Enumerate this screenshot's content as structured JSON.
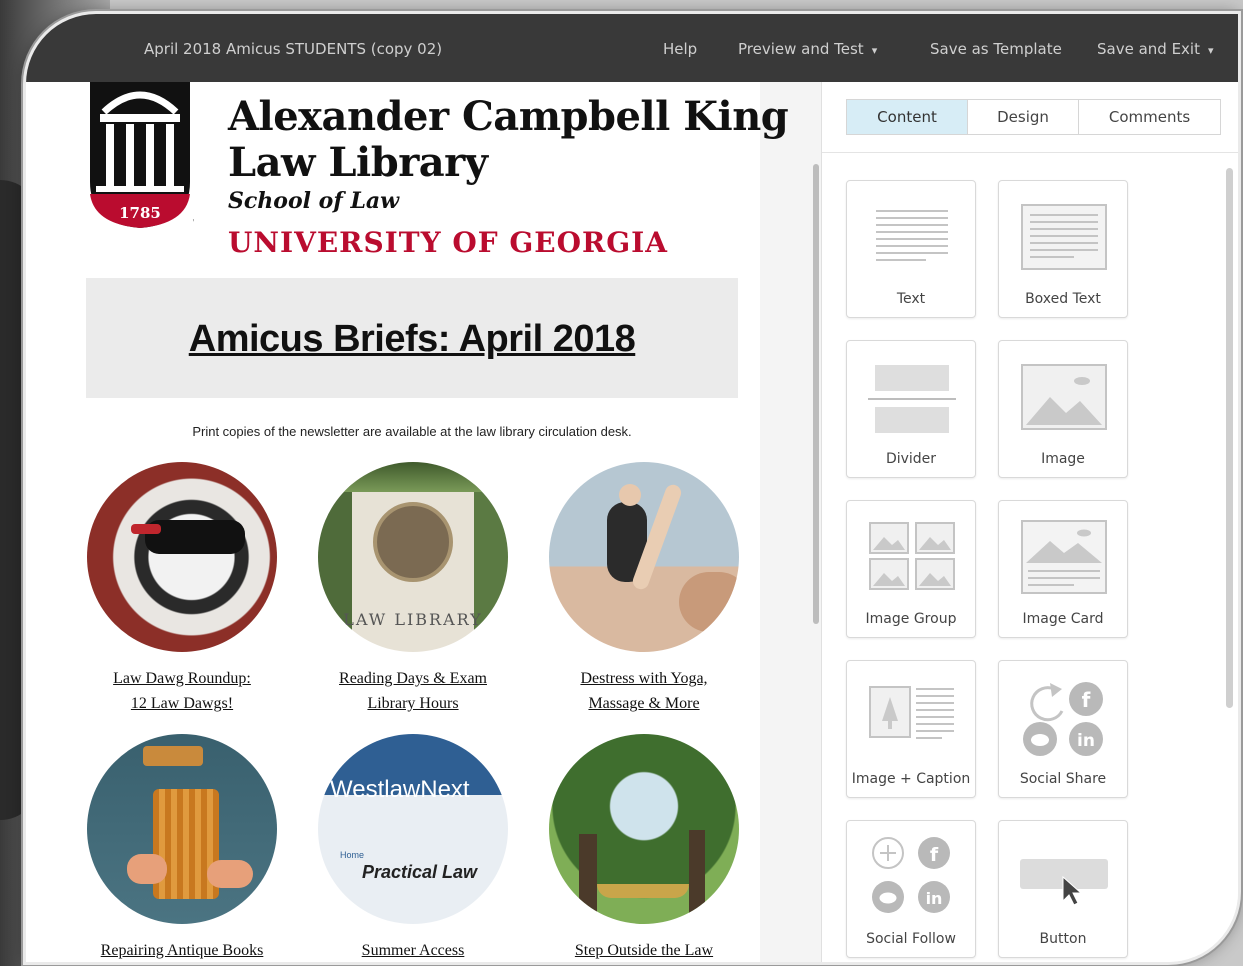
{
  "toolbar": {
    "campaign_title": "April 2018 Amicus STUDENTS (copy 02)",
    "help": "Help",
    "preview_test": "Preview and Test",
    "save_template": "Save as Template",
    "save_exit": "Save and Exit",
    "caret": "⌄"
  },
  "newsletter": {
    "brand_line1": "Alexander Campbell King",
    "brand_line2": "Law Library",
    "school": "School of Law",
    "university": "UNIVERSITY OF GEORGIA",
    "logo_year": "1785",
    "logo_mark": "™",
    "headline": "Amicus Briefs: April 2018",
    "notice": "Print copies of the newsletter are available at the law library circulation desk.",
    "stories": [
      {
        "line1": "Law Dawg Roundup:",
        "line2": "12 Law Dawgs!"
      },
      {
        "line1": "Reading Days & Exam",
        "line2": "Library Hours"
      },
      {
        "line1": "Destress with Yoga,",
        "line2": "Massage & More"
      },
      {
        "line1": "Repairing Antique Books",
        "line2": ""
      },
      {
        "line1": "Summer Access",
        "line2": ""
      },
      {
        "line1": "Step Outside the Law",
        "line2": ""
      }
    ],
    "photo_texts": {
      "law_library": "LAW LIBRARY",
      "westlaw": "WestlawNext",
      "home": "Home",
      "practical_law": "Practical Law"
    }
  },
  "sidebar": {
    "tabs": [
      "Content",
      "Design",
      "Comments"
    ],
    "active_tab": "Content",
    "blocks": [
      "Text",
      "Boxed Text",
      "Divider",
      "Image",
      "Image Group",
      "Image Card",
      "Image + Caption",
      "Social Share",
      "Social Follow",
      "Button"
    ]
  },
  "colors": {
    "toolbar_bg": "#393939",
    "brand_red": "#ba0c2f",
    "active_tab_bg": "#d7edf6"
  }
}
